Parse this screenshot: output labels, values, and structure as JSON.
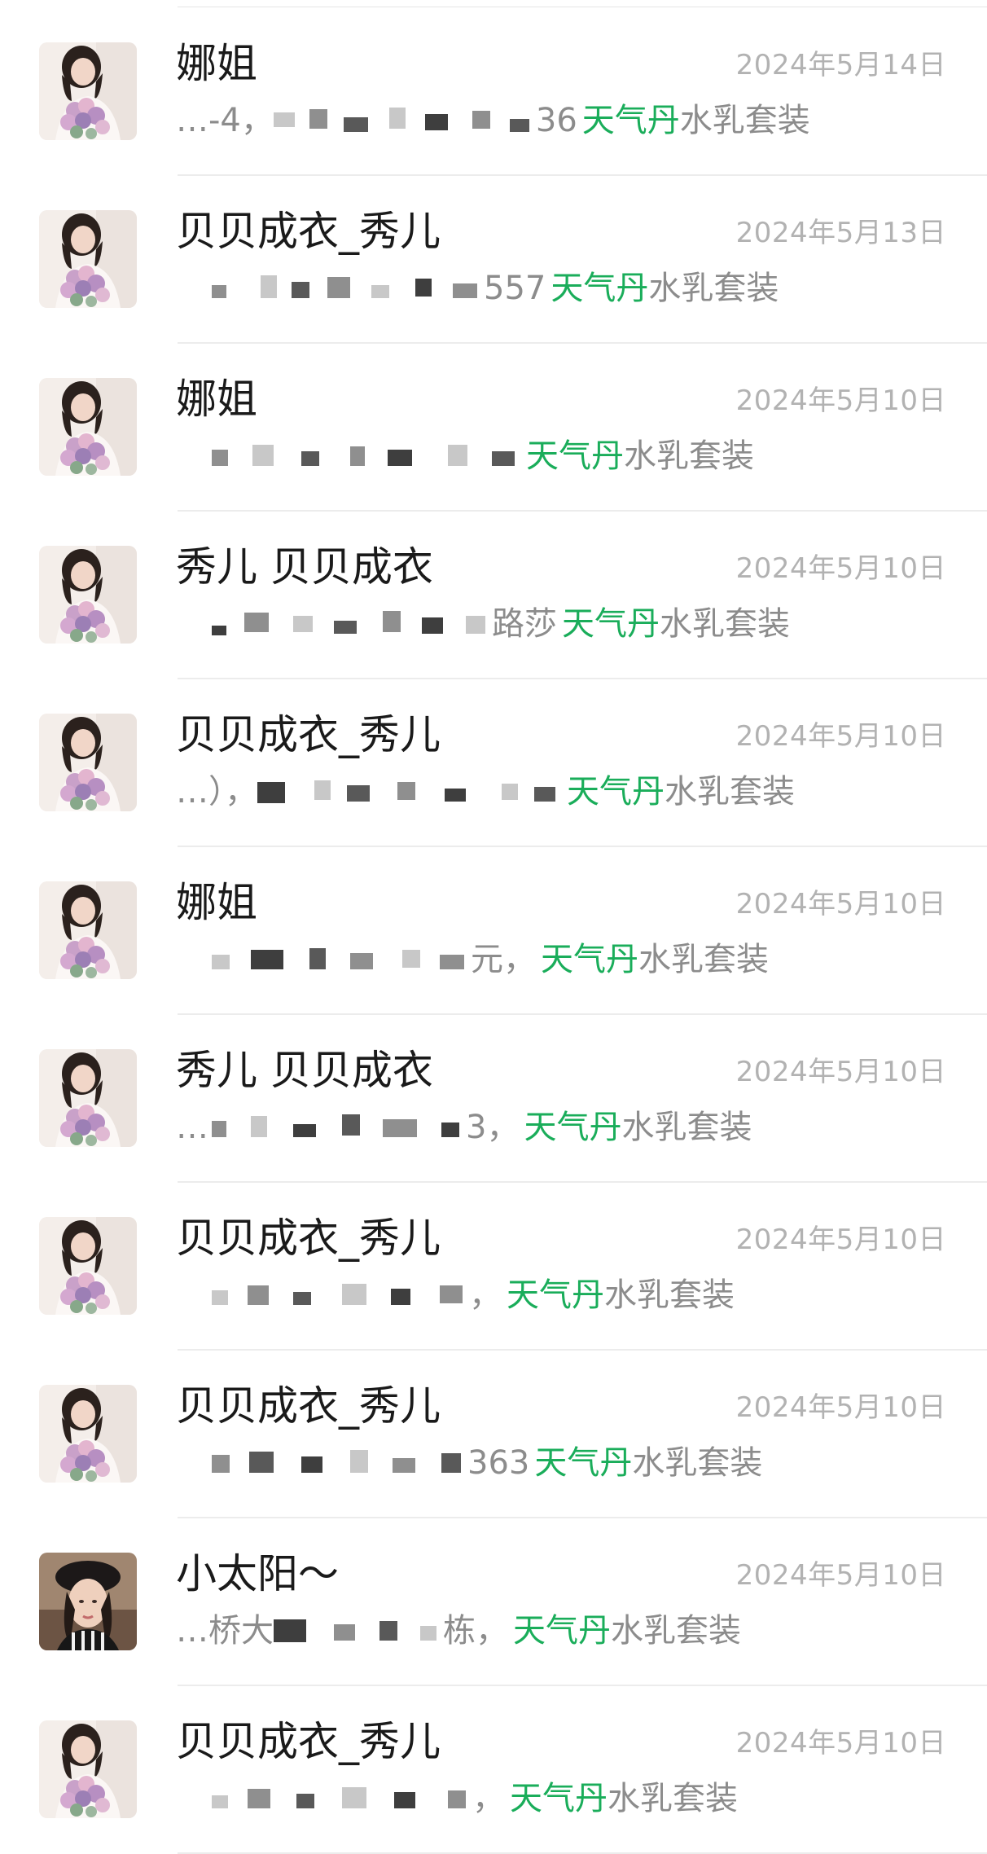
{
  "chats": [
    {
      "name": "娜姐",
      "date": "2024年5月14日",
      "prefix": "…-4，",
      "tail": "36",
      "keyword": "天气丹",
      "product": "水乳套装",
      "avatar": "girl-with-flowers"
    },
    {
      "name": "贝贝成衣_秀儿",
      "date": "2024年5月13日",
      "prefix": "",
      "tail": "557",
      "keyword": "天气丹",
      "product": "水乳套装",
      "avatar": "girl-with-flowers"
    },
    {
      "name": "娜姐",
      "date": "2024年5月10日",
      "prefix": "",
      "tail": "",
      "keyword": "天气丹",
      "product": "水乳套装",
      "avatar": "girl-with-flowers"
    },
    {
      "name": "秀儿 贝贝成衣",
      "date": "2024年5月10日",
      "prefix": "",
      "tail": "路莎",
      "keyword": "天气丹",
      "product": "水乳套装",
      "avatar": "girl-with-flowers"
    },
    {
      "name": "贝贝成衣_秀儿",
      "date": "2024年5月10日",
      "prefix": "…），",
      "tail": "",
      "keyword": "天气丹",
      "product": "水乳套装",
      "avatar": "girl-with-flowers"
    },
    {
      "name": "娜姐",
      "date": "2024年5月10日",
      "prefix": "",
      "tail": "元，",
      "keyword": "天气丹",
      "product": "水乳套装",
      "avatar": "girl-with-flowers"
    },
    {
      "name": "秀儿 贝贝成衣",
      "date": "2024年5月10日",
      "prefix": "…",
      "tail": "3，",
      "keyword": "天气丹",
      "product": "水乳套装",
      "avatar": "girl-with-flowers"
    },
    {
      "name": "贝贝成衣_秀儿",
      "date": "2024年5月10日",
      "prefix": "",
      "tail": "，",
      "keyword": "天气丹",
      "product": "水乳套装",
      "avatar": "girl-with-flowers"
    },
    {
      "name": "贝贝成衣_秀儿",
      "date": "2024年5月10日",
      "prefix": "",
      "tail": "363",
      "keyword": "天气丹",
      "product": "水乳套装",
      "avatar": "girl-with-flowers"
    },
    {
      "name": "小太阳～",
      "date": "2024年5月10日",
      "prefix": "…桥大",
      "tail": "栋，",
      "keyword": "天气丹",
      "product": "水乳套装",
      "avatar": "girl-with-beret"
    },
    {
      "name": "贝贝成衣_秀儿",
      "date": "2024年5月10日",
      "prefix": "",
      "tail": "，",
      "keyword": "天气丹",
      "product": "水乳套装",
      "avatar": "girl-with-flowers"
    }
  ]
}
